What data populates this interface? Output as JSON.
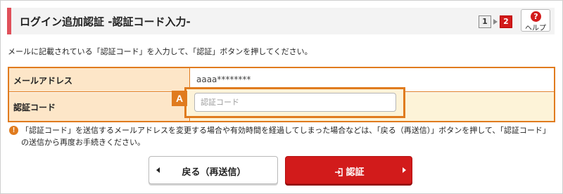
{
  "header": {
    "title": "ログイン追加認証 -認証コード入力-",
    "steps": [
      "1",
      "2"
    ],
    "current_step": "2",
    "help_label": "ヘルプ",
    "help_icon_glyph": "?",
    "accent_color": "#e0505a"
  },
  "instruction": "メールに記載されている「認証コード」を入力して、「認証」ボタンを押してください。",
  "form": {
    "email_label": "メールアドレス",
    "email_value": "aaaa********",
    "code_label": "認証コード",
    "code_placeholder": "認証コード",
    "marker": "A",
    "border_color": "#e07b1e"
  },
  "note": {
    "icon_glyph": "!",
    "text": "「認証コード」を送信するメールアドレスを変更する場合や有効時間を経過してしまった場合などは、「戻る（再送信）」ボタンを押して、「認証コード」の送信から再度お手続きください。"
  },
  "buttons": {
    "back_label": "戻る（再送信）",
    "submit_label": "認証",
    "submit_color": "#d21b1b"
  }
}
